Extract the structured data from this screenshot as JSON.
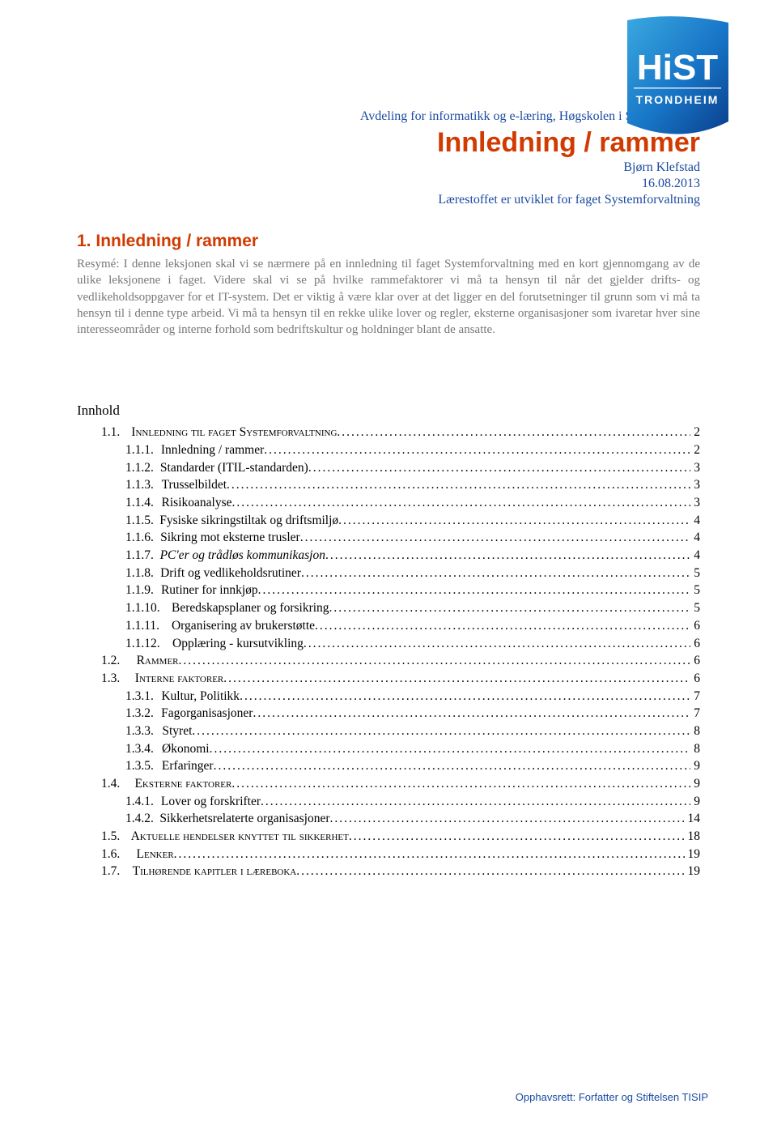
{
  "header": {
    "department": "Avdeling for informatikk og e-læring, Høgskolen i Sør-Trøndelag",
    "title": "Innledning / rammer",
    "author": "Bjørn Klefstad",
    "date": "16.08.2013",
    "course_note": "Lærestoffet er utviklet for faget Systemforvaltning"
  },
  "section1": {
    "number": "1.",
    "title": "Innledning / rammer",
    "resume": "Resymé: I denne leksjonen skal vi se nærmere på en innledning til faget Systemforvaltning med en kort gjennomgang av de ulike leksjonene i faget. Videre skal vi se på hvilke rammefaktorer vi må ta hensyn til når det gjelder drifts- og vedlikeholdsoppgaver for et IT-system. Det er viktig å være klar over at det ligger en del forutsetninger til grunn som vi må ta hensyn til i denne type arbeid. Vi må ta hensyn til en rekke ulike lover og regler, eksterne organisasjoner som ivaretar hver sine interesseområder og interne forhold som bedriftskultur og holdninger blant de ansatte."
  },
  "innhold_title": "Innhold",
  "toc": [
    {
      "num": "1.1.",
      "label": "Innledning til faget Systemforvaltning",
      "page": "2",
      "indent": 1,
      "style": "smallcaps"
    },
    {
      "num": "1.1.1.",
      "label": "Innledning / rammer",
      "page": "2",
      "indent": 2
    },
    {
      "num": "1.1.2.",
      "label": "Standarder (ITIL-standarden)",
      "page": "3",
      "indent": 2
    },
    {
      "num": "1.1.3.",
      "label": "Trusselbildet",
      "page": "3",
      "indent": 2
    },
    {
      "num": "1.1.4.",
      "label": "Risikoanalyse",
      "page": "3",
      "indent": 2
    },
    {
      "num": "1.1.5.",
      "label": "Fysiske sikringstiltak og driftsmiljø",
      "page": "4",
      "indent": 2
    },
    {
      "num": "1.1.6.",
      "label": "Sikring mot eksterne trusler",
      "page": "4",
      "indent": 2
    },
    {
      "num": "1.1.7.",
      "label": "PC'er og trådløs kommunikasjon",
      "page": "4",
      "indent": 2,
      "style": "italic"
    },
    {
      "num": "1.1.8.",
      "label": "Drift og vedlikeholdsrutiner",
      "page": "5",
      "indent": 2
    },
    {
      "num": "1.1.9.",
      "label": "Rutiner for innkjøp",
      "page": "5",
      "indent": 2
    },
    {
      "num": "1.1.10.",
      "label": "Beredskapsplaner og forsikring",
      "page": "5",
      "indent": 2,
      "wide": true
    },
    {
      "num": "1.1.11.",
      "label": "Organisering av brukerstøtte",
      "page": "6",
      "indent": 2,
      "wide": true
    },
    {
      "num": "1.1.12.",
      "label": "Opplæring - kursutvikling",
      "page": "6",
      "indent": 2,
      "wide": true
    },
    {
      "num": "1.2.",
      "label": "Rammer",
      "page": "6",
      "indent": 1,
      "style": "smallcaps"
    },
    {
      "num": "1.3.",
      "label": "Interne faktorer",
      "page": "6",
      "indent": 1,
      "style": "smallcaps"
    },
    {
      "num": "1.3.1.",
      "label": "Kultur, Politikk",
      "page": "7",
      "indent": 2
    },
    {
      "num": "1.3.2.",
      "label": "Fagorganisasjoner",
      "page": "7",
      "indent": 2
    },
    {
      "num": "1.3.3.",
      "label": "Styret",
      "page": "8",
      "indent": 2
    },
    {
      "num": "1.3.4.",
      "label": "Økonomi",
      "page": "8",
      "indent": 2
    },
    {
      "num": "1.3.5.",
      "label": "Erfaringer",
      "page": "9",
      "indent": 2
    },
    {
      "num": "1.4.",
      "label": "Eksterne faktorer",
      "page": "9",
      "indent": 1,
      "style": "smallcaps"
    },
    {
      "num": "1.4.1.",
      "label": "Lover og forskrifter",
      "page": "9",
      "indent": 2
    },
    {
      "num": "1.4.2.",
      "label": "Sikkerhetsrelaterte organisasjoner",
      "page": "14",
      "indent": 2
    },
    {
      "num": "1.5.",
      "label": "Aktuelle hendelser knyttet til sikkerhet",
      "page": "18",
      "indent": 1,
      "style": "smallcaps"
    },
    {
      "num": "1.6.",
      "label": "Lenker",
      "page": "19",
      "indent": 1,
      "style": "smallcaps"
    },
    {
      "num": "1.7.",
      "label": "Tilhørende kapitler i læreboka",
      "page": "19",
      "indent": 1,
      "style": "smallcaps"
    }
  ],
  "copyright": "Opphavsrett: Forfatter og Stiftelsen TISIP",
  "logo": {
    "text_top": "HiST",
    "text_bottom": "TRONDHEIM"
  }
}
